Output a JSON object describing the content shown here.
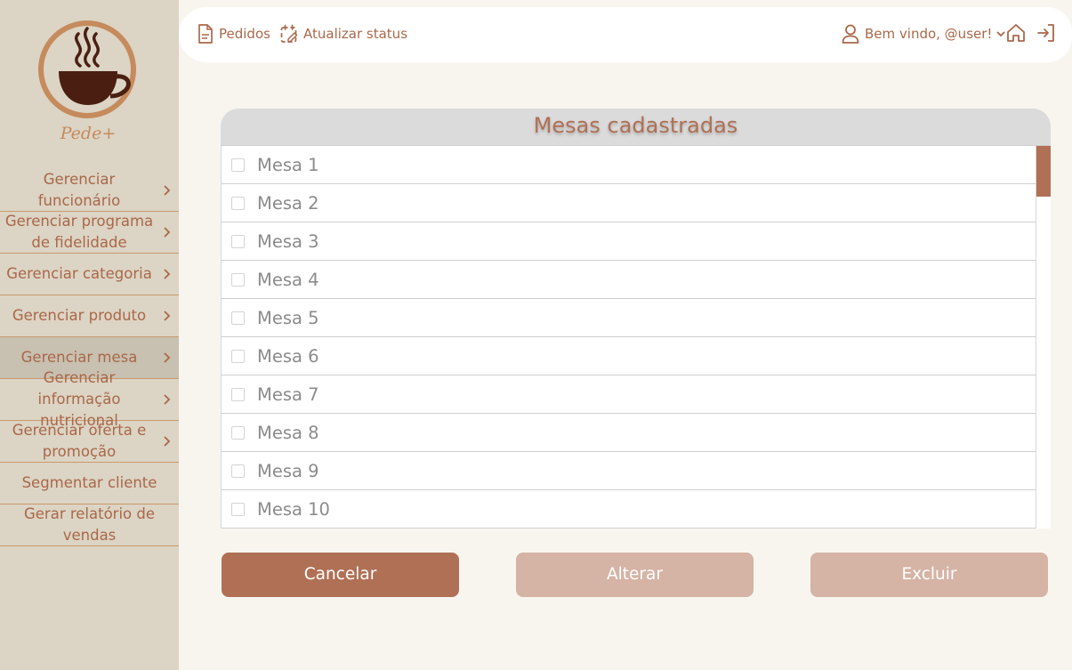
{
  "brand": {
    "name": "Pede+"
  },
  "sidebar": {
    "items": [
      {
        "label": "Gerenciar funcionário",
        "chevron": true
      },
      {
        "label": "Gerenciar programa de fidelidade",
        "chevron": true
      },
      {
        "label": "Gerenciar categoria",
        "chevron": true
      },
      {
        "label": "Gerenciar produto",
        "chevron": true
      },
      {
        "label": "Gerenciar mesa",
        "chevron": true,
        "active": true
      },
      {
        "label": "Gerenciar informação nutricional",
        "chevron": true
      },
      {
        "label": "Gerenciar oferta e promoção",
        "chevron": true
      },
      {
        "label": "Segmentar cliente",
        "chevron": false
      },
      {
        "label": "Gerar relatório de vendas",
        "chevron": false
      }
    ]
  },
  "topbar": {
    "orders_label": "Pedidos",
    "status_label": "Atualizar status",
    "user_label": "Bem vindo, @user!"
  },
  "card": {
    "title": "Mesas cadastradas",
    "rows": [
      "Mesa 1",
      "Mesa 2",
      "Mesa 3",
      "Mesa 4",
      "Mesa 5",
      "Mesa 6",
      "Mesa 7",
      "Mesa 8",
      "Mesa 9",
      "Mesa 10"
    ]
  },
  "actions": {
    "cancel_label": "Cancelar",
    "edit_label": "Alterar",
    "delete_label": "Excluir"
  },
  "colors": {
    "accent": "#b07055",
    "accent_disabled": "#d5b3a5",
    "sidebar_bg": "#dcd4c4",
    "text_brown": "#a9684a"
  }
}
